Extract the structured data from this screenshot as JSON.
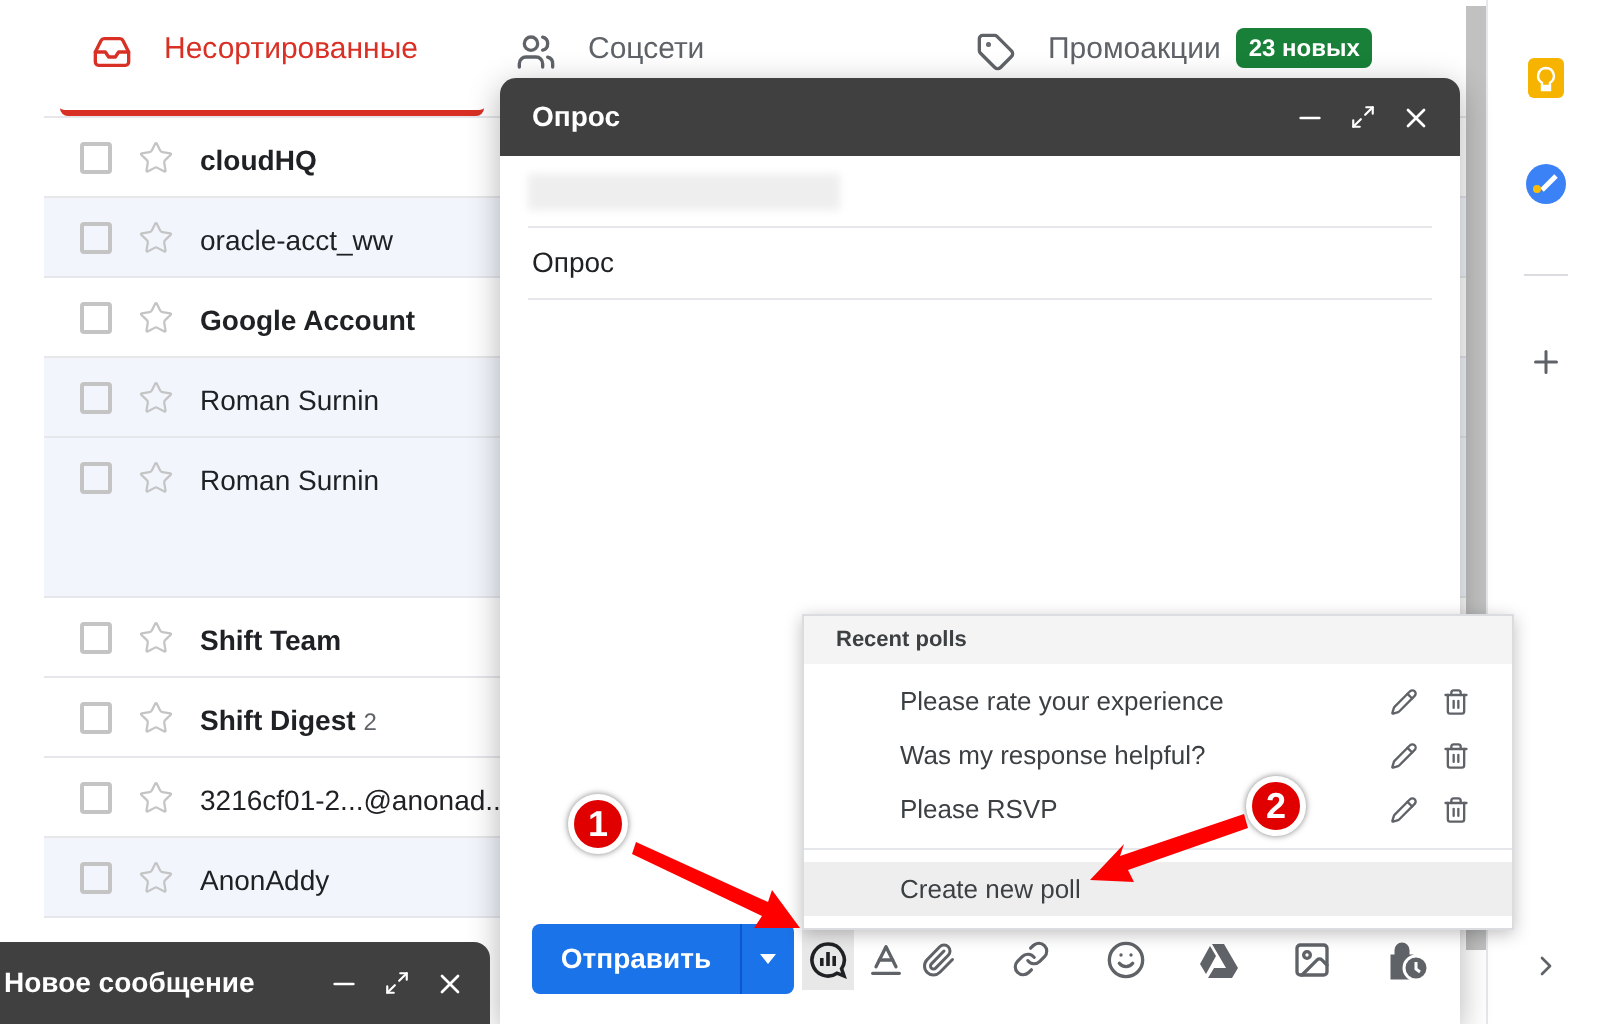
{
  "tabs": [
    {
      "label": "Несортированные",
      "selected": true,
      "kind": "inbox"
    },
    {
      "label": "Соцсети",
      "selected": false,
      "kind": "social"
    },
    {
      "label": "Промоакции",
      "selected": false,
      "kind": "promo",
      "badge": "23 новых"
    }
  ],
  "rows": [
    {
      "sender": "cloudHQ",
      "unread": true,
      "shaded": false,
      "kind": "plain"
    },
    {
      "sender": "oracle-acct_ww",
      "unread": false,
      "shaded": true,
      "kind": "plain"
    },
    {
      "sender": "Google Account",
      "unread": true,
      "shaded": false,
      "kind": "plain"
    },
    {
      "sender": "Roman Surnin",
      "unread": false,
      "shaded": true,
      "kind": "plain"
    },
    {
      "sender": "Roman Surnin",
      "unread": false,
      "shaded": true,
      "kind": "tall"
    },
    {
      "sender": "Shift Team",
      "unread": true,
      "shaded": false,
      "kind": "plain"
    },
    {
      "sender": "Shift Digest",
      "count": "2",
      "unread": true,
      "shaded": false,
      "kind": "plain"
    },
    {
      "sender": "3216cf01-2...@anonad..",
      "unread": false,
      "shaded": false,
      "kind": "plain"
    },
    {
      "sender": "AnonAddy",
      "unread": false,
      "shaded": true,
      "kind": "plain"
    }
  ],
  "compose": {
    "title": "Опрос",
    "subject": "Опрос",
    "send_button": "Отправить"
  },
  "poll_menu": {
    "header": "Recent polls",
    "polls": [
      "Please rate your experience",
      "Was my response helpful?",
      "Please RSVP"
    ],
    "create": "Create new poll"
  },
  "minimized_compose": {
    "title": "Новое сообщение"
  },
  "annotations": [
    {
      "label": "1"
    },
    {
      "label": "2"
    }
  ]
}
